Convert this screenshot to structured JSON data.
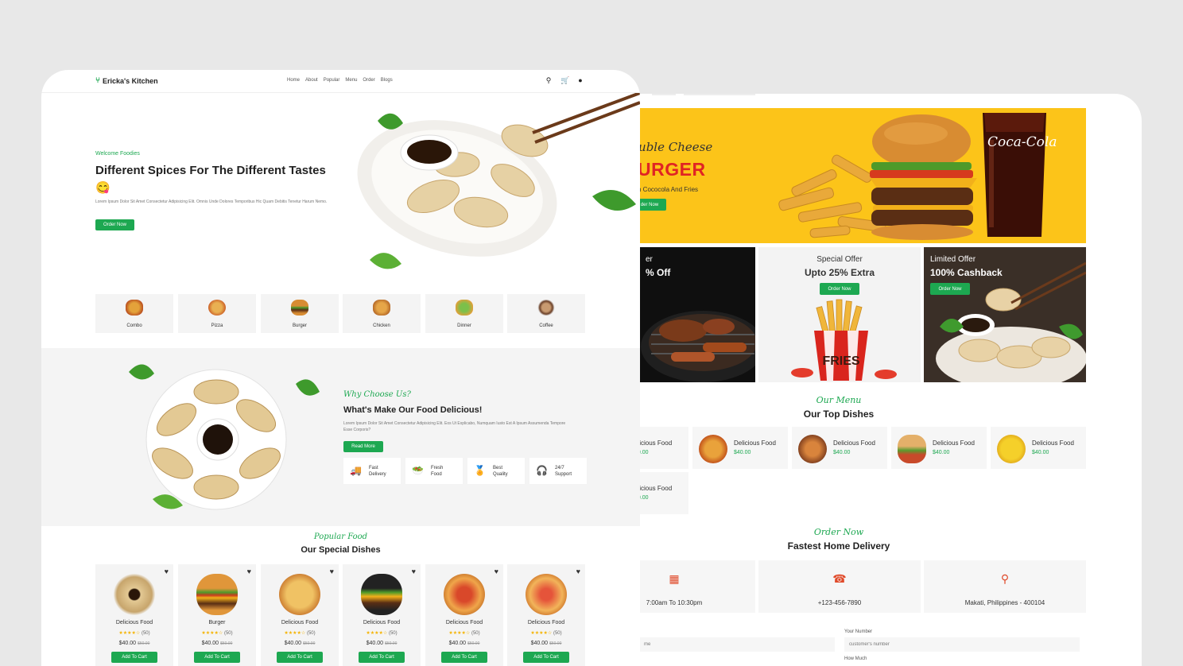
{
  "right": {
    "hero": {
      "script": "ouble Cheese",
      "big": "URGER",
      "sub": "h Cococola And Fries",
      "btn": "der Now",
      "brand": "Coca-Cola"
    },
    "offers": [
      {
        "sub": "er",
        "title": "% Off",
        "btn": ""
      },
      {
        "sub": "Special Offer",
        "title": "Upto 25% Extra",
        "btn": "Order Now"
      },
      {
        "sub": "Limited Offer",
        "title": "100% Cashback",
        "btn": "Order Now"
      }
    ],
    "fries_box_text": "FRIES",
    "menu_script": "Our Menu",
    "menu_title": "Our Top Dishes",
    "dishes": [
      {
        "name": "elicious Food",
        "price": "$0.00"
      },
      {
        "name": "Delicious Food",
        "price": "$40.00"
      },
      {
        "name": "Delicious Food",
        "price": "$40.00"
      },
      {
        "name": "Delicious Food",
        "price": "$40.00"
      },
      {
        "name": "Delicious Food",
        "price": "$40.00"
      },
      {
        "name": "elicious Food",
        "price": "$0.00"
      }
    ],
    "order_script": "Order Now",
    "order_title": "Fastest Home Delivery",
    "contacts": [
      {
        "icon": "calendar-icon",
        "text": "7:00am To 10:30pm"
      },
      {
        "icon": "phone-icon",
        "text": "+123-456-7890"
      },
      {
        "icon": "map-pin-icon",
        "text": "Makati, Philippines - 400104"
      }
    ],
    "form": {
      "left_placeholder": "me",
      "number_label": "Your Number",
      "number_placeholder": "customer's number",
      "how_much_label": "How Much"
    }
  },
  "left": {
    "logo": "Ericka's Kitchen",
    "nav": [
      "Home",
      "About",
      "Popular",
      "Menu",
      "Order",
      "Blogs"
    ],
    "welcome": "Welcome Foodies",
    "hero_title": "Different Spices For The Different Tastes 😋",
    "hero_desc": "Lorem Ipsum Dolor Sit Amet Consectetur Adipisicing Elit. Omnis Unde Dolores Temporibus Hic Quam Debitis Tenetur Harum Nemo.",
    "order_btn": "Order Now",
    "categories": [
      "Combo",
      "Pizza",
      "Burger",
      "Chicken",
      "Dinner",
      "Coffee"
    ],
    "why_script": "Why Choose Us?",
    "why_title": "What's Make Our Food Delicious!",
    "why_desc": "Lorem Ipsum Dolor Sit Amet Consectetur Adipisicing Elit. Eos Ut Explicabo, Numquam Iusto Est A Ipsum Assumenda Tempore Esse Corporis?",
    "read_more": "Read More",
    "features": [
      {
        "l1": "Fast",
        "l2": "Delivery",
        "icon": "🚚"
      },
      {
        "l1": "Fresh",
        "l2": "Food",
        "icon": "🥗"
      },
      {
        "l1": "Best",
        "l2": "Quality",
        "icon": "🏅"
      },
      {
        "l1": "24/7",
        "l2": "Support",
        "icon": "🎧"
      }
    ],
    "popular_script": "Popular Food",
    "popular_title": "Our Special Dishes",
    "products": [
      {
        "name": "Delicious Food",
        "stars": "★★★★☆",
        "count": "(50)",
        "price": "$40.00",
        "old": "$50.00",
        "btn": "Add To Cart"
      },
      {
        "name": "Burger",
        "stars": "★★★★☆",
        "count": "(50)",
        "price": "$40.00",
        "old": "$50.00",
        "btn": "Add To Cart"
      },
      {
        "name": "Delicious Food",
        "stars": "★★★★☆",
        "count": "(50)",
        "price": "$40.00",
        "old": "$50.00",
        "btn": "Add To Cart"
      },
      {
        "name": "Delicious Food",
        "stars": "★★★★☆",
        "count": "(50)",
        "price": "$40.00",
        "old": "$50.00",
        "btn": "Add To Cart"
      },
      {
        "name": "Delicious Food",
        "stars": "★★★★☆",
        "count": "(50)",
        "price": "$40.00",
        "old": "$50.00",
        "btn": "Add To Cart"
      },
      {
        "name": "Delicious Food",
        "stars": "★★★★☆",
        "count": "(50)",
        "price": "$40.00",
        "old": "$50.00",
        "btn": "Add To Cart"
      }
    ]
  }
}
